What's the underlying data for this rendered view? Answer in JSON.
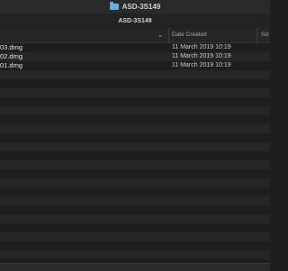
{
  "window": {
    "title": "ASD-3S149",
    "folder_icon": "folder-icon"
  },
  "pathbar": {
    "label": "ASD-3S149"
  },
  "columns": {
    "name": "",
    "date_created": "Date Created",
    "size": "Siz"
  },
  "files": [
    {
      "name": "03.dmg",
      "date_created": "11 March 2019 10:19"
    },
    {
      "name": "02.dmg",
      "date_created": "11 March 2019 10:19"
    },
    {
      "name": "01.dmg",
      "date_created": "11 March 2019 10:19"
    }
  ],
  "colors": {
    "background": "#1e1e1e",
    "alt_row": "#262626",
    "folder": "#5fb0e6"
  }
}
